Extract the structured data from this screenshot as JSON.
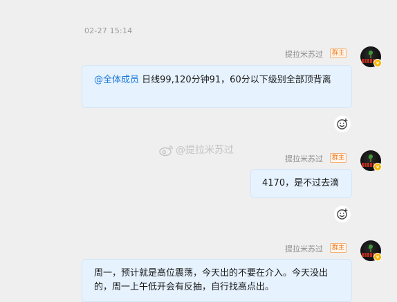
{
  "chat": {
    "timestamp": "02-27 15:14",
    "messages": [
      {
        "sender": "提拉米苏过",
        "role_badge": "群主",
        "mention": "@全体成员",
        "text": " 日线99,120分钟91，60分以下级别全部顶背离"
      },
      {
        "sender": "提拉米苏过",
        "role_badge": "群主",
        "text": "4170，是不过去滴"
      },
      {
        "sender": "提拉米苏过",
        "role_badge": "群主",
        "text": "周一，预计就是高位震荡，今天出的不要在介入。今天没出的，周一上午低开会有反抽，自行找高点出。"
      }
    ],
    "watermark": "@提拉米苏过",
    "verified_badge": "v"
  },
  "colors": {
    "background": "#efefef",
    "bubble": "#e6f2fe",
    "mention": "#1d78d9",
    "owner_badge": "#f07a22",
    "verified": "#f7b500"
  },
  "icons": {
    "reaction": "smiley-add-icon",
    "watermark_logo": "weibo-logo-icon"
  }
}
